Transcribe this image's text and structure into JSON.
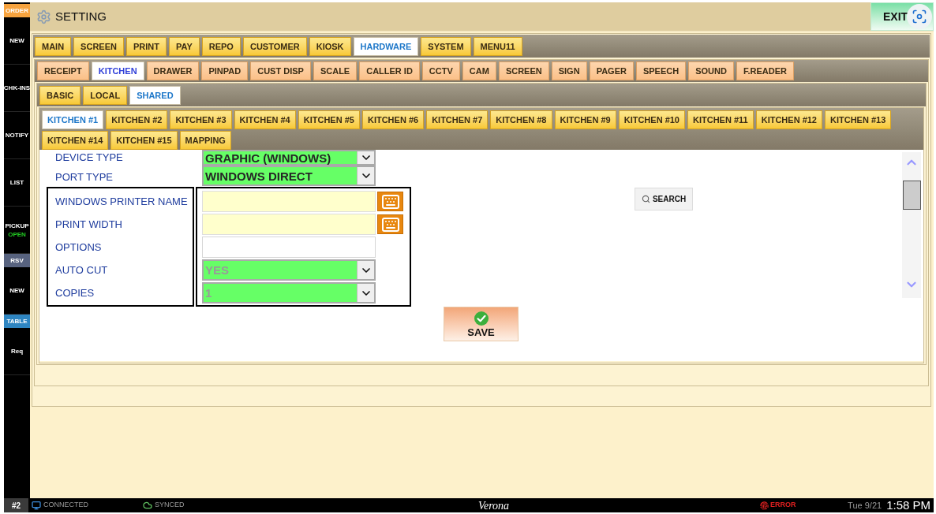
{
  "sidebar": {
    "items": [
      {
        "label": "ORDER",
        "color": "#f7a33e"
      },
      {
        "label": "NEW"
      },
      {
        "label": "CHK-INS"
      },
      {
        "label": "NOTIFY"
      },
      {
        "label": "LIST"
      },
      {
        "label": "PICKUP",
        "status": "OPEN"
      },
      {
        "label": "RSV",
        "color": "#58637f"
      },
      {
        "label": "NEW"
      },
      {
        "label": "TABLE",
        "color": "#2e85c1"
      },
      {
        "label": "Req"
      }
    ]
  },
  "header": {
    "title": "SETTING",
    "exit_label": "EXIT"
  },
  "menu_tabs": [
    {
      "label": "MAIN",
      "selected": false
    },
    {
      "label": "SCREEN",
      "selected": false
    },
    {
      "label": "PRINT",
      "selected": false
    },
    {
      "label": "PAY",
      "selected": false
    },
    {
      "label": "REPO",
      "selected": false
    },
    {
      "label": "CUSTOMER",
      "selected": false
    },
    {
      "label": "KIOSK",
      "selected": false
    },
    {
      "label": "HARDWARE",
      "selected": true
    },
    {
      "label": "SYSTEM",
      "selected": false
    },
    {
      "label": "MENU11",
      "selected": false
    }
  ],
  "device_tabs": [
    {
      "label": "RECEIPT",
      "selected": false
    },
    {
      "label": "KITCHEN",
      "selected": true
    },
    {
      "label": "DRAWER",
      "selected": false
    },
    {
      "label": "PINPAD",
      "selected": false
    },
    {
      "label": "CUST DISP",
      "selected": false
    },
    {
      "label": "SCALE",
      "selected": false
    },
    {
      "label": "CALLER ID",
      "selected": false
    },
    {
      "label": "CCTV",
      "selected": false
    },
    {
      "label": "CAM",
      "selected": false
    },
    {
      "label": "SCREEN",
      "selected": false
    },
    {
      "label": "SIGN",
      "selected": false
    },
    {
      "label": "PAGER",
      "selected": false
    },
    {
      "label": "SPEECH",
      "selected": false
    },
    {
      "label": "SOUND",
      "selected": false
    },
    {
      "label": "F.READER",
      "selected": false
    }
  ],
  "mode_tabs": [
    {
      "label": "BASIC",
      "selected": false
    },
    {
      "label": "LOCAL",
      "selected": false
    },
    {
      "label": "SHARED",
      "selected": true
    }
  ],
  "printer_tabs": [
    {
      "label": "KITCHEN #1",
      "selected": true
    },
    {
      "label": "KITCHEN #2",
      "selected": false
    },
    {
      "label": "KITCHEN #3",
      "selected": false
    },
    {
      "label": "KITCHEN #4",
      "selected": false
    },
    {
      "label": "KITCHEN #5",
      "selected": false
    },
    {
      "label": "KITCHEN #6",
      "selected": false
    },
    {
      "label": "KITCHEN #7",
      "selected": false
    },
    {
      "label": "KITCHEN #8",
      "selected": false
    },
    {
      "label": "KITCHEN #9",
      "selected": false
    },
    {
      "label": "KITCHEN #10",
      "selected": false
    },
    {
      "label": "KITCHEN #11",
      "selected": false
    },
    {
      "label": "KITCHEN #12",
      "selected": false
    },
    {
      "label": "KITCHEN #13",
      "selected": false
    },
    {
      "label": "KITCHEN #14",
      "selected": false
    },
    {
      "label": "KITCHEN #15",
      "selected": false
    },
    {
      "label": "MAPPING",
      "selected": false
    }
  ],
  "form": {
    "fields": [
      {
        "label": "DEVICE TYPE",
        "kind": "select",
        "value": "GRAPHIC (WINDOWS)",
        "disabled": false
      },
      {
        "label": "PORT TYPE",
        "kind": "select",
        "value": "WINDOWS DIRECT",
        "disabled": false
      }
    ],
    "framed_fields": [
      {
        "label": "WINDOWS PRINTER NAME",
        "kind": "keyboard_input"
      },
      {
        "label": "PRINT WIDTH",
        "kind": "keyboard_input"
      },
      {
        "label": "OPTIONS",
        "kind": "input"
      },
      {
        "label": "AUTO CUT",
        "kind": "select",
        "value": "YES",
        "disabled": true
      },
      {
        "label": "COPIES",
        "kind": "select",
        "value": "1",
        "disabled": true
      }
    ],
    "search_button": "SEARCH",
    "save_button": "SAVE"
  },
  "status_bar": {
    "station": "#2",
    "connection": "CONNECTED",
    "sync": "SYNCED",
    "location": "Verona",
    "error": "ERROR",
    "date": "Tue 9/21",
    "time": "1:58 PM"
  }
}
